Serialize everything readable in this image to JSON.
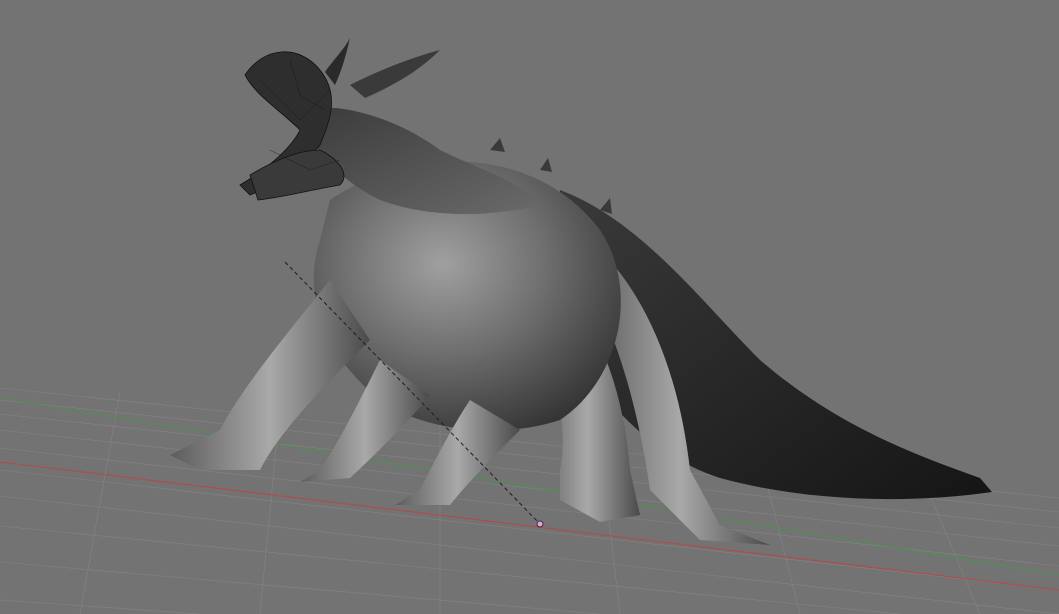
{
  "viewport": {
    "background": "#737373",
    "grid_color": "#8a8a8a",
    "x_axis_color": "#b44a4a",
    "y_axis_color": "#4f8f4f",
    "mesh_light": "#9a9a9a",
    "mesh_dark": "#262626",
    "object_origin_color": "#e6a0e6"
  }
}
